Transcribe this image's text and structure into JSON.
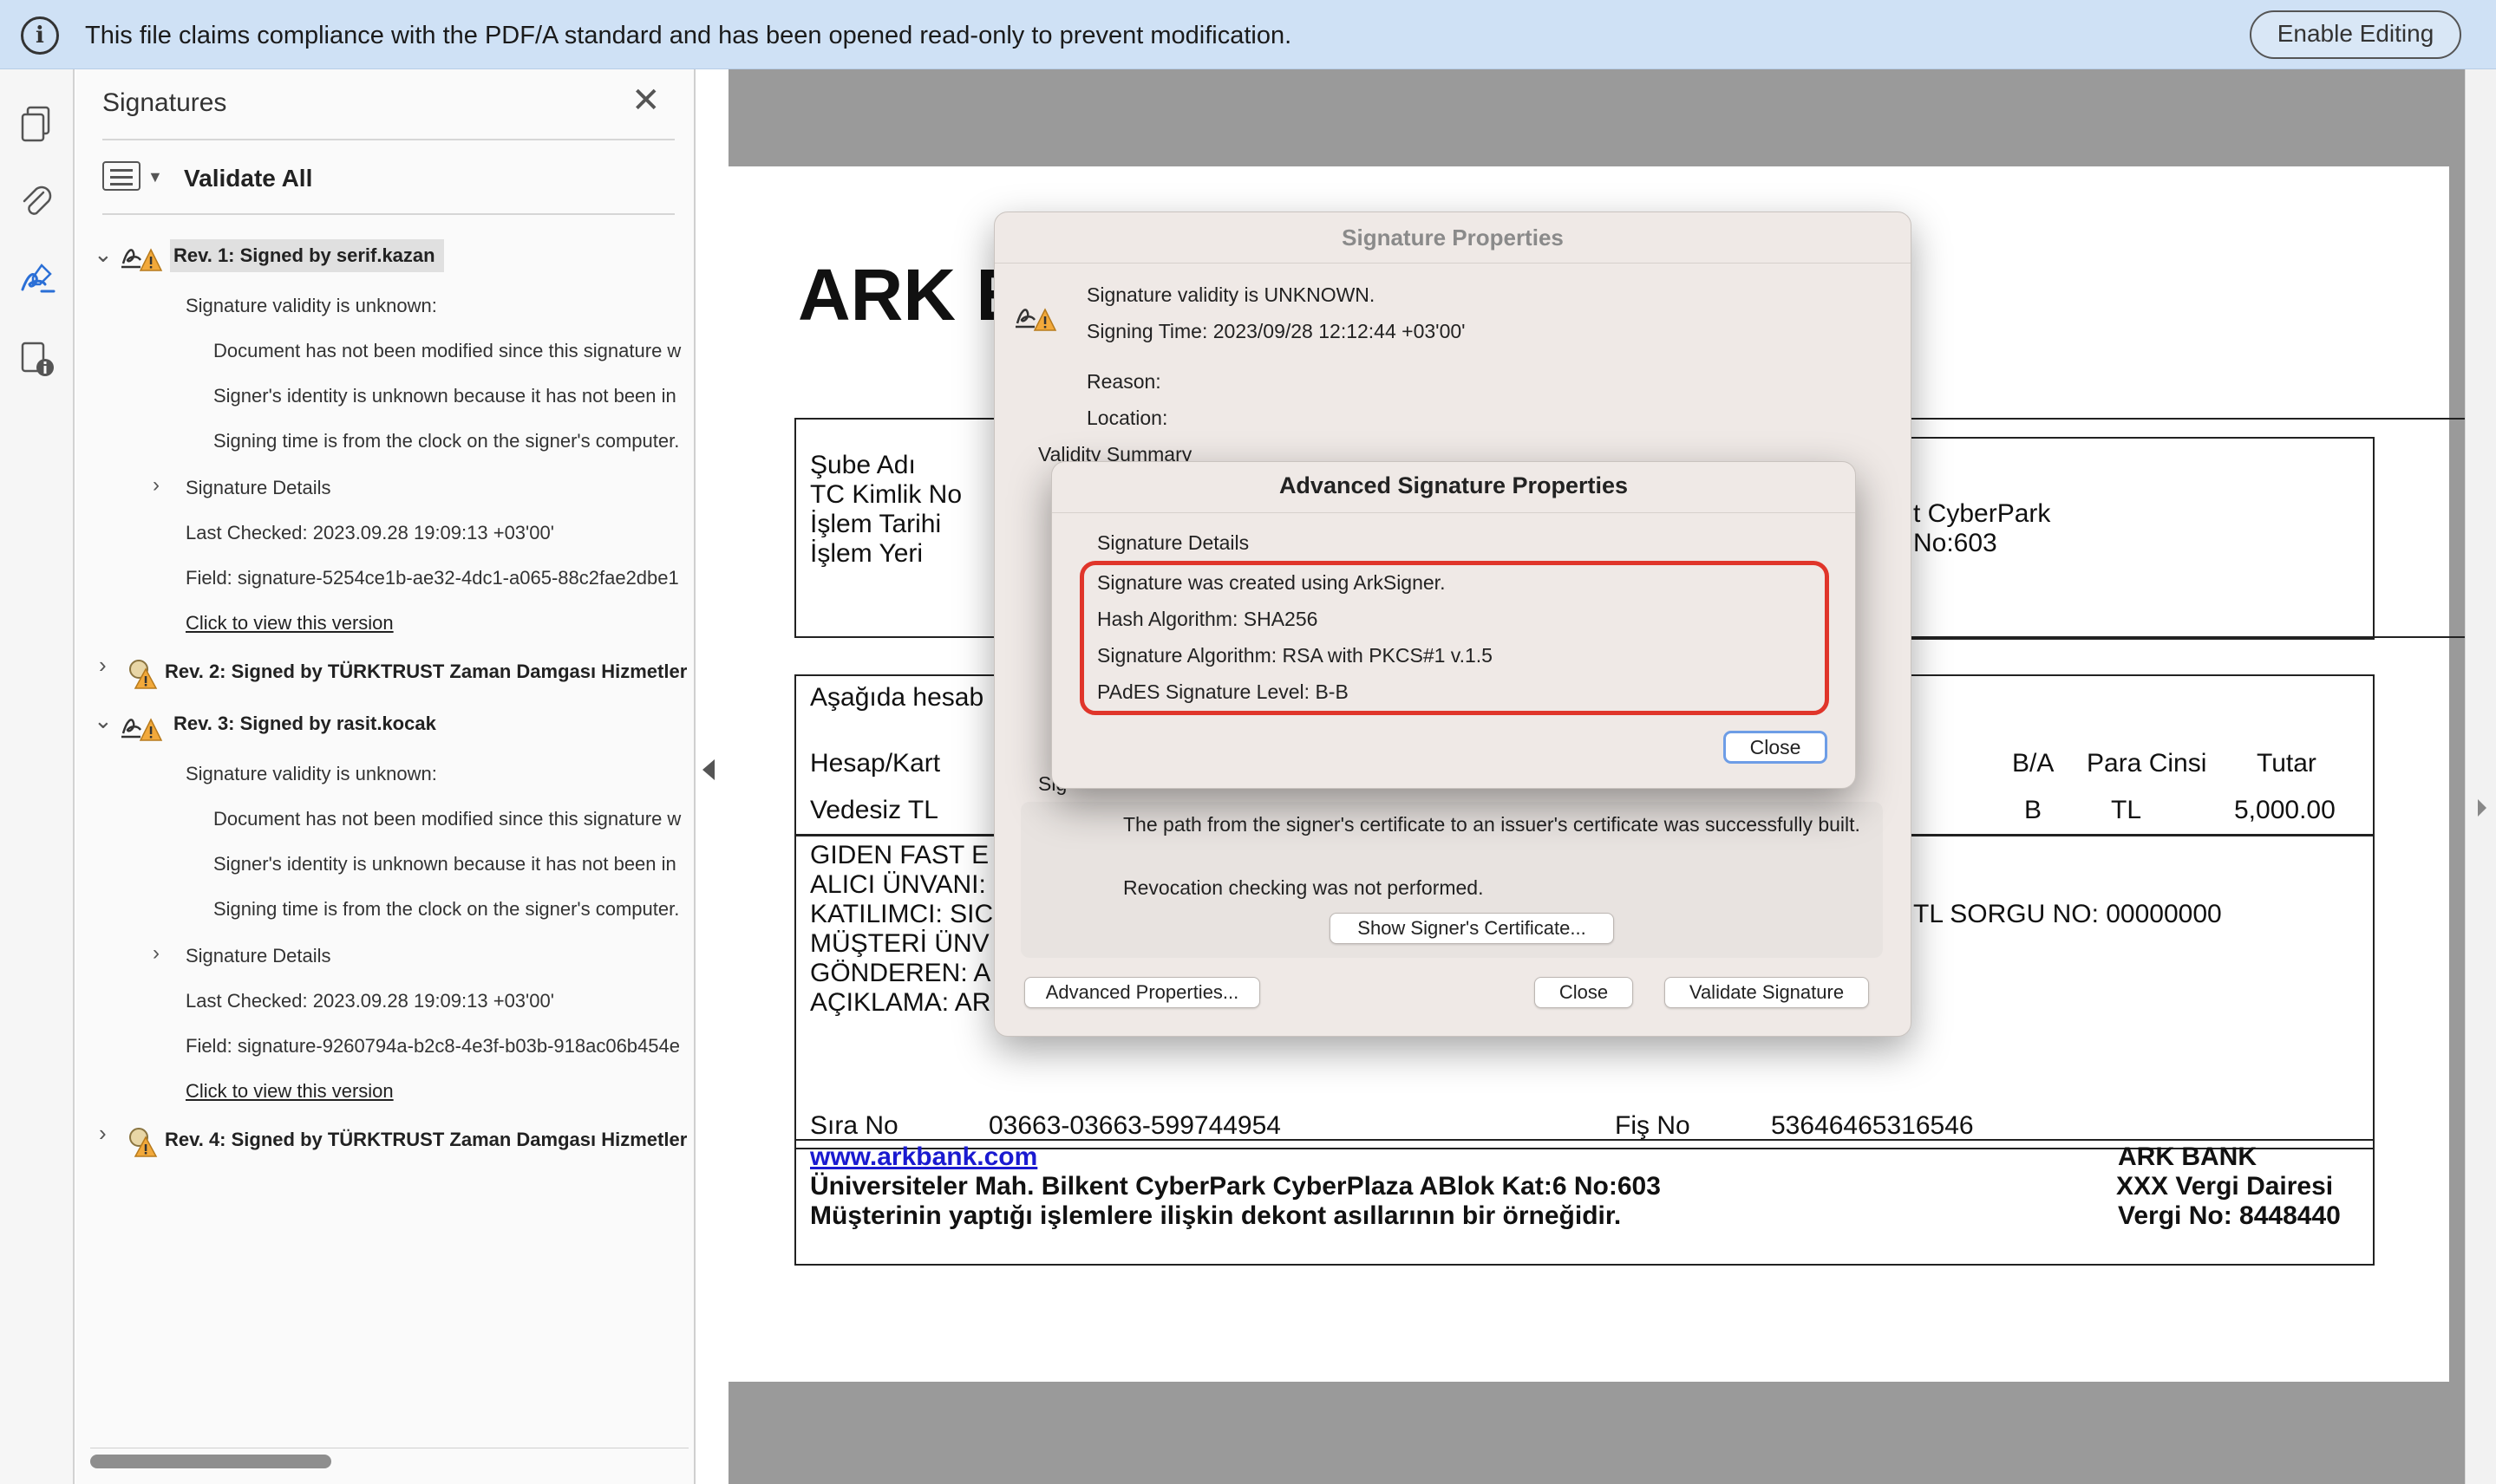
{
  "infobar": {
    "message": "This file claims compliance with the PDF/A standard and has been opened read-only to prevent modification.",
    "enable_button": "Enable Editing"
  },
  "rail": {
    "tools": [
      "pages-icon",
      "attachment-icon",
      "signature-icon",
      "document-info-icon"
    ]
  },
  "panel": {
    "title": "Signatures",
    "validate_all": "Validate All",
    "revisions": [
      {
        "label": "Rev. 1: Signed by serif.kazan",
        "expanded": true,
        "validity": "Signature validity is unknown:",
        "details": [
          "Document has not been modified since this signature w",
          "Signer's identity is unknown because it has not been in",
          "Signing time is from the clock on the signer's computer."
        ],
        "sig_details": "Signature Details",
        "last_checked": "Last Checked: 2023.09.28 19:09:13 +03'00'",
        "field": "Field: signature-5254ce1b-ae32-4dc1-a065-88c2fae2dbe1",
        "view_link": "Click to view this version"
      },
      {
        "label": "Rev. 2: Signed by TÜRKTRUST Zaman Damgası Hizmetler",
        "expanded": false
      },
      {
        "label": "Rev. 3: Signed by rasit.kocak",
        "expanded": true,
        "validity": "Signature validity is unknown:",
        "details": [
          "Document has not been modified since this signature w",
          "Signer's identity is unknown because it has not been in",
          "Signing time is from the clock on the signer's computer."
        ],
        "sig_details": "Signature Details",
        "last_checked": "Last Checked: 2023.09.28 19:09:13 +03'00'",
        "field": "Field: signature-9260794a-b2c8-4e3f-b03b-918ac06b454e",
        "view_link": "Click to view this version"
      },
      {
        "label": "Rev. 4: Signed by TÜRKTRUST Zaman Damgası Hizmetler",
        "expanded": false
      }
    ]
  },
  "document": {
    "title": "ARK E",
    "box1": {
      "labels": [
        "Şube Adı",
        "TC Kimlik No",
        "İşlem Tarihi",
        "İşlem Yeri"
      ],
      "right_lines": [
        "t CyberPark",
        "No:603"
      ]
    },
    "box2": {
      "intro": "Aşağıda hesab",
      "col_account": "Hesap/Kart",
      "col_ba": "B/A",
      "col_currency": "Para Cinsi",
      "col_amount": "Tutar",
      "row_account": "Vedesiz TL",
      "row_ba": "B",
      "row_currency": "TL",
      "row_amount": "5,000.00",
      "lines": [
        "GIDEN FAST E",
        "ALICI ÜNVANI:",
        "KATILIMCI: SIC",
        "MÜŞTERİ ÜNV",
        "GÖNDEREN: A",
        "AÇIKLAMA: AR"
      ],
      "sorgu": "TL SORGU NO: 00000000",
      "sira_label": "Sıra No",
      "sira_value": "03663-03663-599744954",
      "fis_label": "Fiş No",
      "fis_value": "53646465316546"
    },
    "footer": {
      "link": "www.arkbank.com",
      "address": "Üniversiteler Mah. Bilkent CyberPark CyberPlaza ABlok Kat:6 No:603",
      "note": "Müşterinin yaptığı işlemlere ilişkin dekont asıllarının bir örneğidir.",
      "bank": "ARK BANK",
      "tax_office": "XXX Vergi Dairesi",
      "tax_no": "Vergi No: 8448440"
    }
  },
  "sig_props": {
    "title": "Signature Properties",
    "validity": "Signature validity is UNKNOWN.",
    "signing_time": "Signing Time:  2023/09/28 12:12:44 +03'00'",
    "reason": "Reason:",
    "location": "Location:",
    "validity_summary": "Validity Summary",
    "sig_partial": "Sig",
    "path_msg": "The path from the signer's certificate to an issuer's certificate was successfully built.",
    "revocation_msg": "Revocation checking was not performed.",
    "show_cert_button": "Show Signer's Certificate...",
    "advanced_button": "Advanced Properties...",
    "close_button": "Close",
    "validate_button": "Validate Signature"
  },
  "advanced": {
    "title": "Advanced Signature Properties",
    "section": "Signature Details",
    "lines": [
      "Signature was created using ArkSigner.",
      "Hash Algorithm: SHA256",
      "Signature Algorithm: RSA with PKCS#1 v.1.5",
      "PAdES Signature Level: B-B"
    ],
    "close_button": "Close",
    "highlight_color": "#e0352a"
  }
}
